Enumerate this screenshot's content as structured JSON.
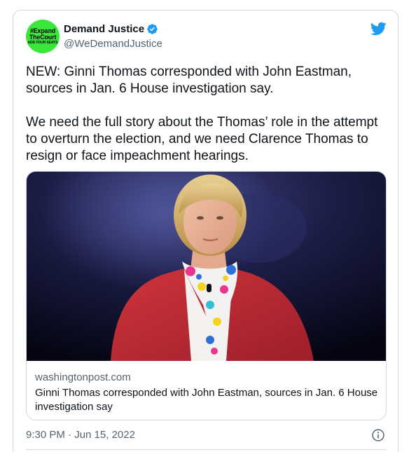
{
  "account": {
    "avatar_lines": [
      "#Expand",
      "TheCourt",
      "ADD FOUR SEATS"
    ],
    "display_name": "Demand Justice",
    "handle": "@WeDemandJustice",
    "verified": true
  },
  "tweet": {
    "text": "NEW: Ginni Thomas corresponded with John Eastman, sources in Jan. 6 House investigation say.\n\nWe need the full story about the Thomas’ role in the attempt to overturn the election, and we need Clarence Thomas to resign or face impeachment hearings.",
    "timestamp": "9:30 PM · Jun 15, 2022"
  },
  "link_card": {
    "domain": "washingtonpost.com",
    "title": "Ginni Thomas corresponded with John Eastman, sources in Jan. 6 House investigation say"
  },
  "icons": {
    "brand": "twitter-bird-icon",
    "verified": "verified-badge-icon",
    "info": "info-icon"
  },
  "colors": {
    "twitter_blue": "#1d9bf0",
    "avatar_green": "#39e639",
    "text_primary": "#0f1419",
    "text_secondary": "#536471",
    "border": "#cfd9de"
  }
}
